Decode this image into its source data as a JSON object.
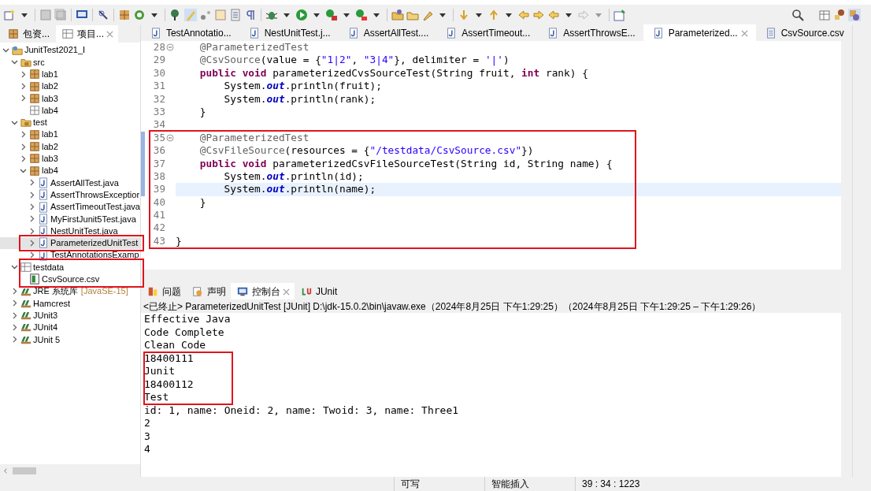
{
  "left_panel": {
    "tabs": [
      {
        "label": "包资...",
        "selected": false,
        "closable": false
      },
      {
        "label": "项目...",
        "selected": true,
        "closable": true
      }
    ],
    "tree": [
      {
        "label": "JunitTest2021_I",
        "kind": "project",
        "expanded": true,
        "selected": false,
        "children": [
          {
            "label": "src",
            "kind": "srcfolder",
            "expanded": true,
            "selected": false,
            "children": [
              {
                "label": "lab1",
                "kind": "package",
                "expanded": false,
                "selected": false
              },
              {
                "label": "lab2",
                "kind": "package",
                "expanded": false,
                "selected": false
              },
              {
                "label": "lab3",
                "kind": "package",
                "expanded": false,
                "selected": false
              },
              {
                "label": "lab4",
                "kind": "emptypackage",
                "selected": false
              }
            ]
          },
          {
            "label": "test",
            "kind": "srcfolder",
            "expanded": true,
            "selected": false,
            "children": [
              {
                "label": "lab1",
                "kind": "package",
                "expanded": false,
                "selected": false
              },
              {
                "label": "lab2",
                "kind": "package",
                "expanded": false,
                "selected": false
              },
              {
                "label": "lab3",
                "kind": "package",
                "expanded": false,
                "selected": false
              },
              {
                "label": "lab4",
                "kind": "package",
                "expanded": true,
                "selected": false,
                "children": [
                  {
                    "label": "AssertAllTest.java",
                    "kind": "java",
                    "expanded": false,
                    "selected": false
                  },
                  {
                    "label": "AssertThrowsExceptior",
                    "kind": "java",
                    "expanded": false,
                    "selected": false
                  },
                  {
                    "label": "AssertTimeoutTest.java",
                    "kind": "java",
                    "expanded": false,
                    "selected": false
                  },
                  {
                    "label": "MyFirstJunit5Test.java",
                    "kind": "java",
                    "expanded": false,
                    "selected": false
                  },
                  {
                    "label": "NestUnitTest.java",
                    "kind": "java",
                    "expanded": false,
                    "selected": false
                  },
                  {
                    "label": "ParameterizedUnitTest",
                    "kind": "java",
                    "expanded": false,
                    "selected": true
                  },
                  {
                    "label": "TestAnnotationsExamp",
                    "kind": "java",
                    "expanded": false,
                    "selected": false
                  }
                ]
              }
            ]
          },
          {
            "label": "testdata",
            "kind": "folder",
            "expanded": true,
            "selected": false,
            "children": [
              {
                "label": "CsvSource.csv",
                "kind": "csv",
                "selected": false
              }
            ]
          },
          {
            "label": "JRE 系统库",
            "suffix": "[JavaSE-15]",
            "kind": "library",
            "expanded": false,
            "selected": false
          },
          {
            "label": "Hamcrest",
            "kind": "library",
            "expanded": false,
            "selected": false
          },
          {
            "label": "JUnit3",
            "kind": "library",
            "expanded": false,
            "selected": false
          },
          {
            "label": "JUnit4",
            "kind": "library",
            "expanded": false,
            "selected": false
          },
          {
            "label": "JUnit 5",
            "kind": "library",
            "expanded": false,
            "selected": false
          }
        ]
      }
    ]
  },
  "editor": {
    "tabs": [
      {
        "label": "TestAnnotatio...",
        "kind": "java",
        "selected": false
      },
      {
        "label": "NestUnitTest.j...",
        "kind": "java",
        "selected": false
      },
      {
        "label": "AssertAllTest....",
        "kind": "java",
        "selected": false
      },
      {
        "label": "AssertTimeout...",
        "kind": "java",
        "selected": false
      },
      {
        "label": "AssertThrowsE...",
        "kind": "java",
        "selected": false
      },
      {
        "label": "Parameterized...",
        "kind": "java",
        "selected": true
      },
      {
        "label": "CsvSource.csv",
        "kind": "text",
        "selected": false
      }
    ],
    "lines": [
      {
        "number": "28",
        "fold": true,
        "changed": false,
        "current": false,
        "tokens": [
          {
            "kind": "ann",
            "text": "    @ParameterizedTest"
          }
        ]
      },
      {
        "number": "29",
        "fold": false,
        "changed": false,
        "current": false,
        "tokens": [
          {
            "kind": "ann",
            "text": "    @CsvSource"
          },
          {
            "kind": "plain",
            "text": "(value = {"
          },
          {
            "kind": "str",
            "text": "\"1|2\""
          },
          {
            "kind": "plain",
            "text": ", "
          },
          {
            "kind": "str",
            "text": "\"3|4\""
          },
          {
            "kind": "plain",
            "text": "}, delimiter = "
          },
          {
            "kind": "str",
            "text": "'|'"
          },
          {
            "kind": "plain",
            "text": ")"
          }
        ]
      },
      {
        "number": "30",
        "fold": false,
        "changed": false,
        "current": false,
        "tokens": [
          {
            "kind": "kw",
            "text": "    public void"
          },
          {
            "kind": "plain",
            "text": " parameterizedCvsSourceTest(String fruit, "
          },
          {
            "kind": "kw",
            "text": "int"
          },
          {
            "kind": "plain",
            "text": " rank) {"
          }
        ]
      },
      {
        "number": "31",
        "fold": false,
        "changed": false,
        "current": false,
        "tokens": [
          {
            "kind": "plain",
            "text": "        System."
          },
          {
            "kind": "field",
            "text": "out"
          },
          {
            "kind": "plain",
            "text": ".println(fruit);"
          }
        ]
      },
      {
        "number": "32",
        "fold": false,
        "changed": false,
        "current": false,
        "tokens": [
          {
            "kind": "plain",
            "text": "        System."
          },
          {
            "kind": "field",
            "text": "out"
          },
          {
            "kind": "plain",
            "text": ".println(rank);"
          }
        ]
      },
      {
        "number": "33",
        "fold": false,
        "changed": false,
        "current": false,
        "tokens": [
          {
            "kind": "plain",
            "text": "    }"
          }
        ]
      },
      {
        "number": "34",
        "fold": false,
        "changed": false,
        "current": false
      },
      {
        "number": "35",
        "fold": true,
        "changed": true,
        "current": false,
        "tokens": [
          {
            "kind": "ann",
            "text": "    @ParameterizedTest"
          }
        ]
      },
      {
        "number": "36",
        "fold": false,
        "changed": true,
        "current": false,
        "tokens": [
          {
            "kind": "ann",
            "text": "    @CsvFileSource"
          },
          {
            "kind": "plain",
            "text": "(resources = {"
          },
          {
            "kind": "str",
            "text": "\"/testdata/CsvSource.csv\""
          },
          {
            "kind": "plain",
            "text": "})"
          }
        ]
      },
      {
        "number": "37",
        "fold": false,
        "changed": true,
        "current": false,
        "tokens": [
          {
            "kind": "kw",
            "text": "    public void"
          },
          {
            "kind": "plain",
            "text": " parameterizedCsvFileSourceTest(String id, String name) {"
          }
        ]
      },
      {
        "number": "38",
        "fold": false,
        "changed": true,
        "current": false,
        "tokens": [
          {
            "kind": "plain",
            "text": "        System."
          },
          {
            "kind": "field",
            "text": "out"
          },
          {
            "kind": "plain",
            "text": ".println(id);"
          }
        ]
      },
      {
        "number": "39",
        "fold": false,
        "changed": true,
        "current": true,
        "tokens": [
          {
            "kind": "plain",
            "text": "        System."
          },
          {
            "kind": "field",
            "text": "out"
          },
          {
            "kind": "plain",
            "text": ".println(name);"
          }
        ]
      },
      {
        "number": "40",
        "fold": false,
        "changed": false,
        "current": false,
        "tokens": [
          {
            "kind": "plain",
            "text": "    }"
          }
        ]
      },
      {
        "number": "41",
        "fold": false,
        "changed": false,
        "current": false
      },
      {
        "number": "42",
        "fold": false,
        "changed": false,
        "current": false
      },
      {
        "number": "43",
        "fold": false,
        "changed": false,
        "current": false,
        "tokens": [
          {
            "kind": "plain",
            "text": "}"
          }
        ]
      }
    ]
  },
  "console": {
    "tabs": [
      {
        "label": "问题",
        "kind": "problems",
        "selected": false
      },
      {
        "label": "声明",
        "kind": "declaration",
        "selected": false
      },
      {
        "label": "控制台",
        "kind": "console",
        "selected": true
      },
      {
        "label": "JUnit",
        "kind": "junit",
        "selected": false
      }
    ],
    "header": "<已终止> ParameterizedUnitTest [JUnit] D:\\jdk-15.0.2\\bin\\javaw.exe（2024年8月25日 下午1:29:25）（2024年8月25日 下午1:29:25 – 下午1:29:26）",
    "output": [
      "Effective Java",
      "Code Complete",
      "Clean Code",
      "18400111",
      "Junit",
      "18400112",
      "Test",
      "id: 1, name: Oneid: 2, name: Twoid: 3, name: Three1",
      "2",
      "3",
      "4"
    ]
  },
  "status_bar": [
    "可写",
    "智能插入",
    "39 : 34 : 1223"
  ]
}
